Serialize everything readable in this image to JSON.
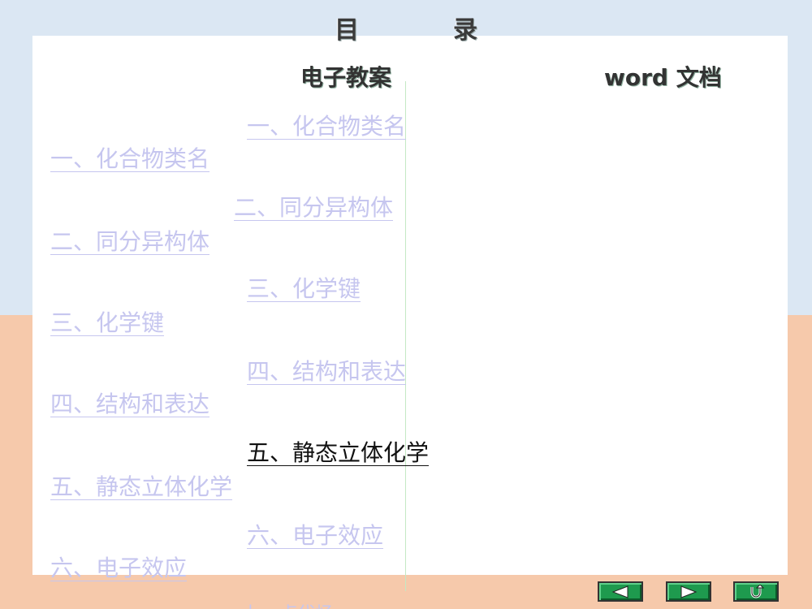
{
  "title": {
    "char1": "目",
    "char2": "录"
  },
  "columns": {
    "slides": "电子教案",
    "word": "word 文档"
  },
  "slide_links": [
    "一、化合物类名",
    "二、同分异构体 ",
    "三、化学键",
    "四、结构和表达",
    "五、静态立体化学",
    "六、电子效应"
  ],
  "word_links": [
    "一、化合物类名 ",
    "二、同分异构体",
    "三、化学键",
    "四、结构和表达",
    "五、静态立体化学 ",
    "六、电子效应"
  ],
  "partial_link": "七、卤代烃",
  "nav": {
    "prev_icon": "triangle-left-icon",
    "next_icon": "triangle-right-icon",
    "return_icon": "return-arrow-icon"
  },
  "colors": {
    "top_bg": "#dbe7f3",
    "bottom_bg": "#f6c9ab",
    "link": "#c6c6ef",
    "active_link": "#111111",
    "button": "#1e9a4e"
  }
}
